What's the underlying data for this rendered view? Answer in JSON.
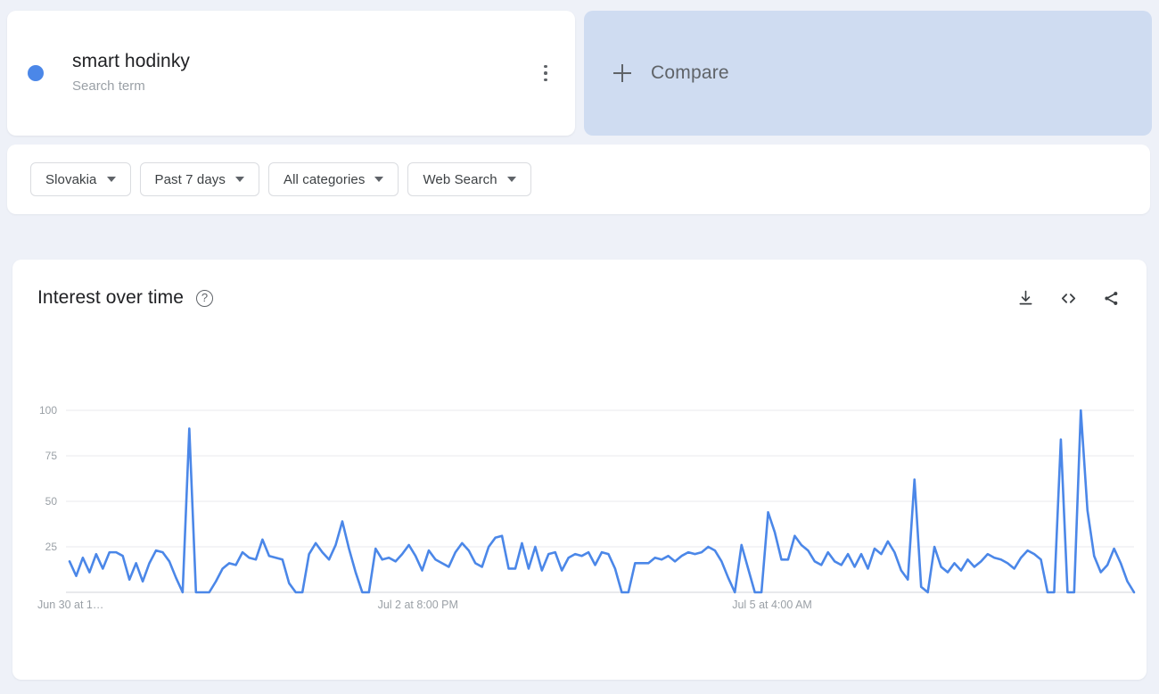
{
  "term_card": {
    "term": "smart hodinky",
    "subtitle": "Search term",
    "dot_color": "#4b87e8",
    "menu_icon": "kebab-menu-icon"
  },
  "compare_card": {
    "label": "Compare",
    "plus_icon": "plus-icon",
    "background": "#cfdcf1"
  },
  "filters": [
    {
      "label": "Slovakia",
      "icon": "chevron-down-icon"
    },
    {
      "label": "Past 7 days",
      "icon": "chevron-down-icon"
    },
    {
      "label": "All categories",
      "icon": "chevron-down-icon"
    },
    {
      "label": "Web Search",
      "icon": "chevron-down-icon"
    }
  ],
  "chart_card": {
    "title": "Interest over time",
    "help_icon": "help-circle-icon",
    "actions": [
      {
        "name": "download-icon",
        "label": "Download"
      },
      {
        "name": "embed-code-icon",
        "label": "Embed"
      },
      {
        "name": "share-icon",
        "label": "Share"
      }
    ]
  },
  "chart_data": {
    "type": "line",
    "title": "Interest over time",
    "subtitle": "",
    "xlabel": "",
    "ylabel": "",
    "ylim": [
      0,
      100
    ],
    "yticks": [
      25,
      50,
      75,
      100
    ],
    "grid": true,
    "legend": false,
    "line_color": "#4b87e8",
    "series_name": "smart hodinky",
    "x_tick_labels": [
      "Jun 30 at 1…",
      "Jul 2 at 8:00 PM",
      "Jul 5 at 4:00 AM"
    ],
    "x_tick_positions": [
      0,
      0.333,
      0.666
    ],
    "values": [
      17,
      9,
      19,
      11,
      21,
      13,
      22,
      22,
      20,
      7,
      16,
      6,
      16,
      23,
      22,
      17,
      8,
      0,
      90,
      0,
      0,
      0,
      6,
      13,
      16,
      15,
      22,
      19,
      18,
      29,
      20,
      19,
      18,
      5,
      0,
      0,
      21,
      27,
      22,
      18,
      26,
      39,
      24,
      11,
      0,
      0,
      24,
      18,
      19,
      17,
      21,
      26,
      20,
      12,
      23,
      18,
      16,
      14,
      22,
      27,
      23,
      16,
      14,
      25,
      30,
      31,
      13,
      13,
      27,
      13,
      25,
      12,
      21,
      22,
      12,
      19,
      21,
      20,
      22,
      15,
      22,
      21,
      13,
      0,
      0,
      16,
      16,
      16,
      19,
      18,
      20,
      17,
      20,
      22,
      21,
      22,
      25,
      23,
      17,
      8,
      0,
      26,
      13,
      0,
      0,
      44,
      33,
      18,
      18,
      31,
      26,
      23,
      17,
      15,
      22,
      17,
      15,
      21,
      14,
      21,
      13,
      24,
      21,
      28,
      22,
      12,
      7,
      62,
      3,
      0,
      25,
      14,
      11,
      16,
      12,
      18,
      14,
      17,
      21,
      19,
      18,
      16,
      13,
      19,
      23,
      21,
      18,
      0,
      0,
      84,
      0,
      0,
      100,
      45,
      20,
      11,
      15,
      24,
      16,
      6,
      0
    ]
  }
}
